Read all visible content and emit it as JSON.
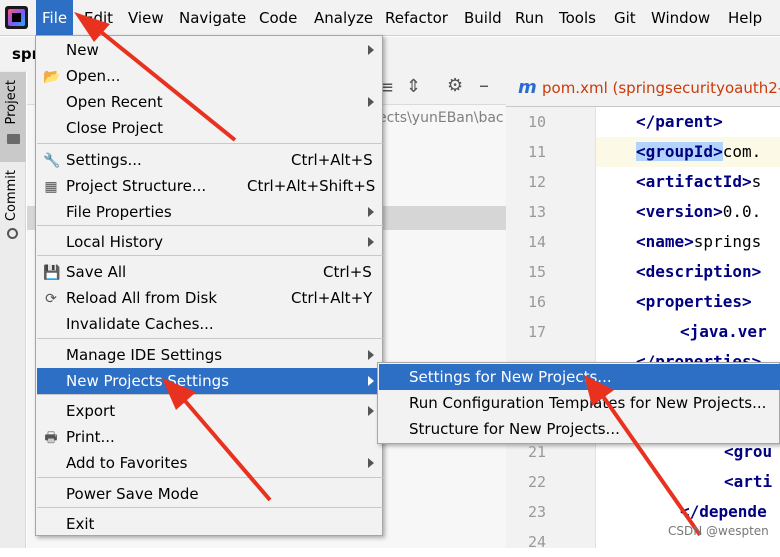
{
  "menubar": {
    "items": [
      "File",
      "Edit",
      "View",
      "Navigate",
      "Code",
      "Analyze",
      "Refactor",
      "Build",
      "Run",
      "Tools",
      "Git",
      "Window",
      "Help"
    ]
  },
  "sidebar": {
    "project_tab": "Project",
    "commit_tab": "Commit",
    "project_title": "spr"
  },
  "project_panel": {
    "path": "ects\\yunEBan\\bac"
  },
  "editor": {
    "tab_title": "pom.xml (springsecurityoauth2-c",
    "line_numbers": [
      "10",
      "11",
      "12",
      "13",
      "14",
      "15",
      "16",
      "17",
      "",
      "",
      "",
      "21",
      "22",
      "23",
      "24"
    ],
    "lines": [
      {
        "tag": "</parent>",
        "text": ""
      },
      {
        "tag": "<groupId>",
        "text": "com."
      },
      {
        "tag": "<artifactId>",
        "text": "s"
      },
      {
        "tag": "<version>",
        "text": "0.0."
      },
      {
        "tag": "<name>",
        "text": "springs"
      },
      {
        "tag": "<description>",
        "text": ""
      },
      {
        "tag": "<properties>",
        "text": ""
      },
      {
        "tag": "<java.ver",
        "text": ""
      },
      {
        "tag": "</properties>",
        "text": ""
      },
      {
        "tag": "<grou",
        "text": ""
      },
      {
        "tag": "<arti",
        "text": ""
      },
      {
        "tag": "</depende",
        "text": ""
      }
    ]
  },
  "file_menu": {
    "items": [
      {
        "label": "New",
        "shortcut": "",
        "submenu": true
      },
      {
        "label": "Open...",
        "shortcut": "",
        "icon": "folder-icon"
      },
      {
        "label": "Open Recent",
        "shortcut": "",
        "submenu": true
      },
      {
        "label": "Close Project",
        "shortcut": ""
      },
      {
        "label": "Settings...",
        "shortcut": "Ctrl+Alt+S",
        "icon": "wrench-icon"
      },
      {
        "label": "Project Structure...",
        "shortcut": "Ctrl+Alt+Shift+S",
        "icon": "project-structure-icon"
      },
      {
        "label": "File Properties",
        "shortcut": "",
        "submenu": true
      },
      {
        "label": "Local History",
        "shortcut": "",
        "submenu": true
      },
      {
        "label": "Save All",
        "shortcut": "Ctrl+S",
        "icon": "save-icon"
      },
      {
        "label": "Reload All from Disk",
        "shortcut": "Ctrl+Alt+Y",
        "icon": "reload-icon"
      },
      {
        "label": "Invalidate Caches...",
        "shortcut": ""
      },
      {
        "label": "Manage IDE Settings",
        "shortcut": "",
        "submenu": true
      },
      {
        "label": "New Projects Settings",
        "shortcut": "",
        "submenu": true,
        "active": true
      },
      {
        "label": "Export",
        "shortcut": "",
        "submenu": true
      },
      {
        "label": "Print...",
        "shortcut": "",
        "icon": "print-icon"
      },
      {
        "label": "Add to Favorites",
        "shortcut": "",
        "submenu": true
      },
      {
        "label": "Power Save Mode",
        "shortcut": ""
      },
      {
        "label": "Exit",
        "shortcut": ""
      }
    ]
  },
  "submenu": {
    "items": [
      "Settings for New Projects...",
      "Run Configuration Templates for New Projects...",
      "Structure for New Projects..."
    ]
  },
  "watermark": "CSDN @wespten",
  "colors": {
    "accent": "#2d6fc4",
    "annotation_arrow": "#e8321f",
    "tag": "#000080"
  }
}
